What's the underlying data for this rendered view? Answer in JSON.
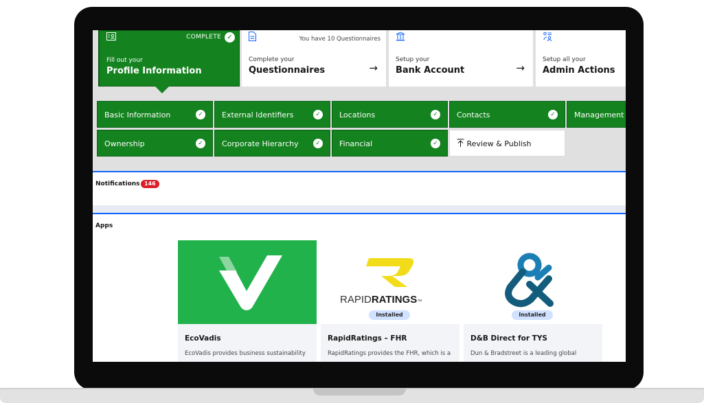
{
  "steps": [
    {
      "icon": "profile-card-icon",
      "status": "COMPLETE",
      "small": "Fill out your",
      "big": "Profile Information"
    },
    {
      "icon": "document-icon",
      "note": "You have 10 Questionnaires",
      "small": "Complete your",
      "big": "Questionnaires",
      "arrow": "→"
    },
    {
      "icon": "bank-icon",
      "small": "Setup your",
      "big": "Bank Account",
      "arrow": "→"
    },
    {
      "icon": "admin-users-icon",
      "small": "Setup all your",
      "big": "Admin Actions"
    }
  ],
  "tiles": {
    "basic": "Basic Information",
    "external": "External Identifiers",
    "locations": "Locations",
    "contacts": "Contacts",
    "management": "Management",
    "ownership": "Ownership",
    "corporate": "Corporate Hierarchy",
    "financial": "Financial",
    "review": "Review & Publish",
    "review_icon": "upload-arrow-icon"
  },
  "notifications": {
    "title": "Notifications",
    "count": "146"
  },
  "apps": {
    "title": "Apps",
    "items": [
      {
        "name": "EcoVadis",
        "desc": "EcoVadis provides business sustainability"
      },
      {
        "name": "RapidRatings – FHR",
        "desc": "RapidRatings provides the FHR, which is a",
        "installed": "Installed",
        "logo_word_light": "RAPID",
        "logo_word_bold": "RATINGS",
        "logo_mark": "™"
      },
      {
        "name": "D&B Direct for TYS",
        "desc": "Dun & Bradstreet is a leading global",
        "installed": "Installed"
      }
    ]
  },
  "colors": {
    "green": "#14821f",
    "blue": "#0f62fe",
    "ecovadis": "#22b24c",
    "badge": "#da1e28",
    "rapid_yellow": "#f2dc1a",
    "dnb_blue": "#1b7eb5",
    "dnb_navy": "#135c7b"
  }
}
